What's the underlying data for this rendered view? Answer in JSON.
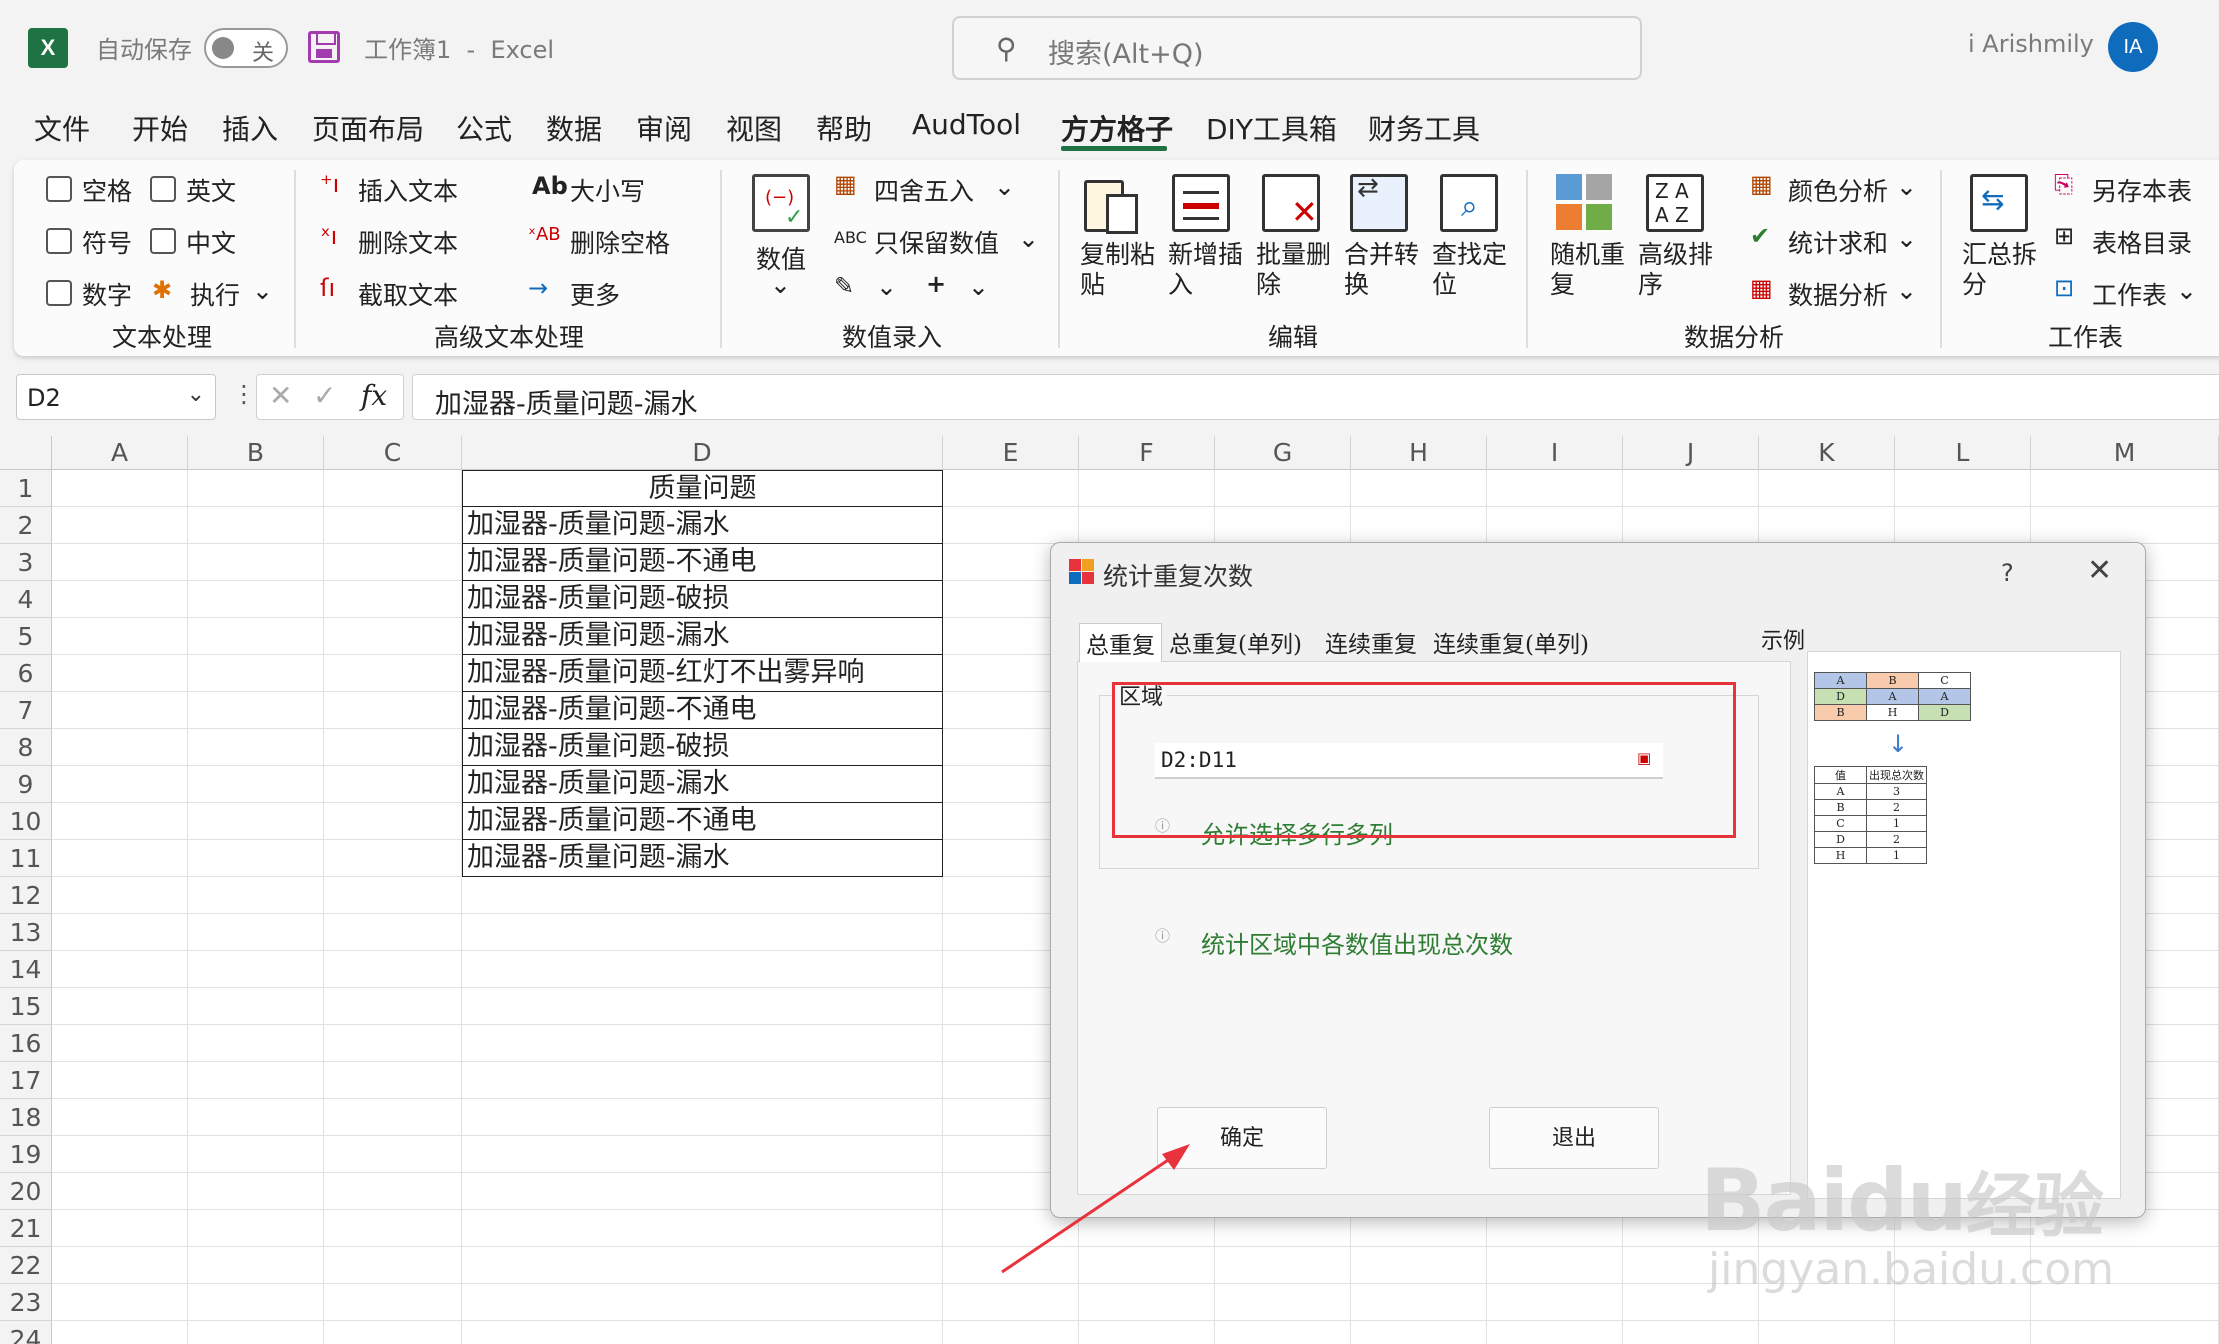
{
  "titlebar": {
    "autosave_label": "自动保存",
    "autosave_state": "关",
    "doc_title": "工作簿1  -  Excel",
    "search_placeholder": "搜索(Alt+Q)",
    "user_name": "i Arishmily",
    "user_initials": "IA"
  },
  "menu": [
    "文件",
    "开始",
    "插入",
    "页面布局",
    "公式",
    "数据",
    "审阅",
    "视图",
    "帮助",
    "AudTool",
    "方方格子",
    "DIY工具箱",
    "财务工具"
  ],
  "menu_active": "方方格子",
  "ribbon": {
    "text_processing": {
      "checkboxes": [
        "空格",
        "英文",
        "符号",
        "中文",
        "数字"
      ],
      "execute": "执行",
      "group": "文本处理"
    },
    "advanced_text": {
      "items": [
        "插入文本",
        "删除文本",
        "截取文本",
        "大小写",
        "删除空格",
        "更多"
      ],
      "group": "高级文本处理"
    },
    "numeric_entry": {
      "value_btn": "数值",
      "round": "四舍五入",
      "keep_numbers": "只保留数值",
      "group": "数值录入"
    },
    "edit": {
      "buttons": [
        "复制粘\n贴",
        "新增插\n入",
        "批量删\n除",
        "合并转\n换",
        "查找定\n位"
      ],
      "group": "编辑"
    },
    "data_analysis": {
      "buttons": [
        "随机重\n复",
        "高级排\n序"
      ],
      "items": [
        "颜色分析",
        "统计求和",
        "数据分析"
      ],
      "group": "数据分析"
    },
    "worksheet": {
      "summary_btn": "汇总拆\n分",
      "items": [
        "另存本表",
        "表格目录",
        "工作表"
      ],
      "group": "工作表"
    }
  },
  "formula_bar": {
    "name_box": "D2",
    "fx": "fx",
    "content": "加湿器-质量问题-漏水"
  },
  "sheet": {
    "columns": [
      "A",
      "B",
      "C",
      "D",
      "E",
      "F",
      "G",
      "H",
      "I",
      "J",
      "K",
      "L",
      "M"
    ],
    "rows": [
      "1",
      "2",
      "3",
      "4",
      "5",
      "6",
      "7",
      "8",
      "9",
      "10",
      "11",
      "12",
      "13",
      "14",
      "15",
      "16",
      "17",
      "18",
      "19",
      "20",
      "21",
      "22",
      "23",
      "24"
    ],
    "column_d": [
      "质量问题",
      "加湿器-质量问题-漏水",
      "加湿器-质量问题-不通电",
      "加湿器-质量问题-破损",
      "加湿器-质量问题-漏水",
      "加湿器-质量问题-红灯不出雾异响",
      "加湿器-质量问题-不通电",
      "加湿器-质量问题-破损",
      "加湿器-质量问题-漏水",
      "加湿器-质量问题-不通电",
      "加湿器-质量问题-漏水"
    ]
  },
  "dialog": {
    "title": "统计重复次数",
    "help": "?",
    "close": "✕",
    "tabs": [
      "总重复",
      "总重复(单列)",
      "连续重复",
      "连续重复(单列)"
    ],
    "area_label": "区域",
    "range_value": "D2:D11",
    "hint_multi": "允许选择多行多列",
    "hint_desc": "统计区域中各数值出现总次数",
    "ok": "确定",
    "exit": "退出",
    "sample_label": "示例",
    "sample_grid": [
      [
        "A",
        "B",
        "C"
      ],
      [
        "D",
        "A",
        "A"
      ],
      [
        "B",
        "H",
        "D"
      ]
    ],
    "sample_headers": [
      "值",
      "出现总次数"
    ],
    "sample_counts": [
      [
        "A",
        "3"
      ],
      [
        "B",
        "2"
      ],
      [
        "C",
        "1"
      ],
      [
        "D",
        "2"
      ],
      [
        "H",
        "1"
      ]
    ]
  },
  "watermark": {
    "brand": "Baidu",
    "brand_cn": "经验",
    "url": "jingyan.baidu.com"
  }
}
